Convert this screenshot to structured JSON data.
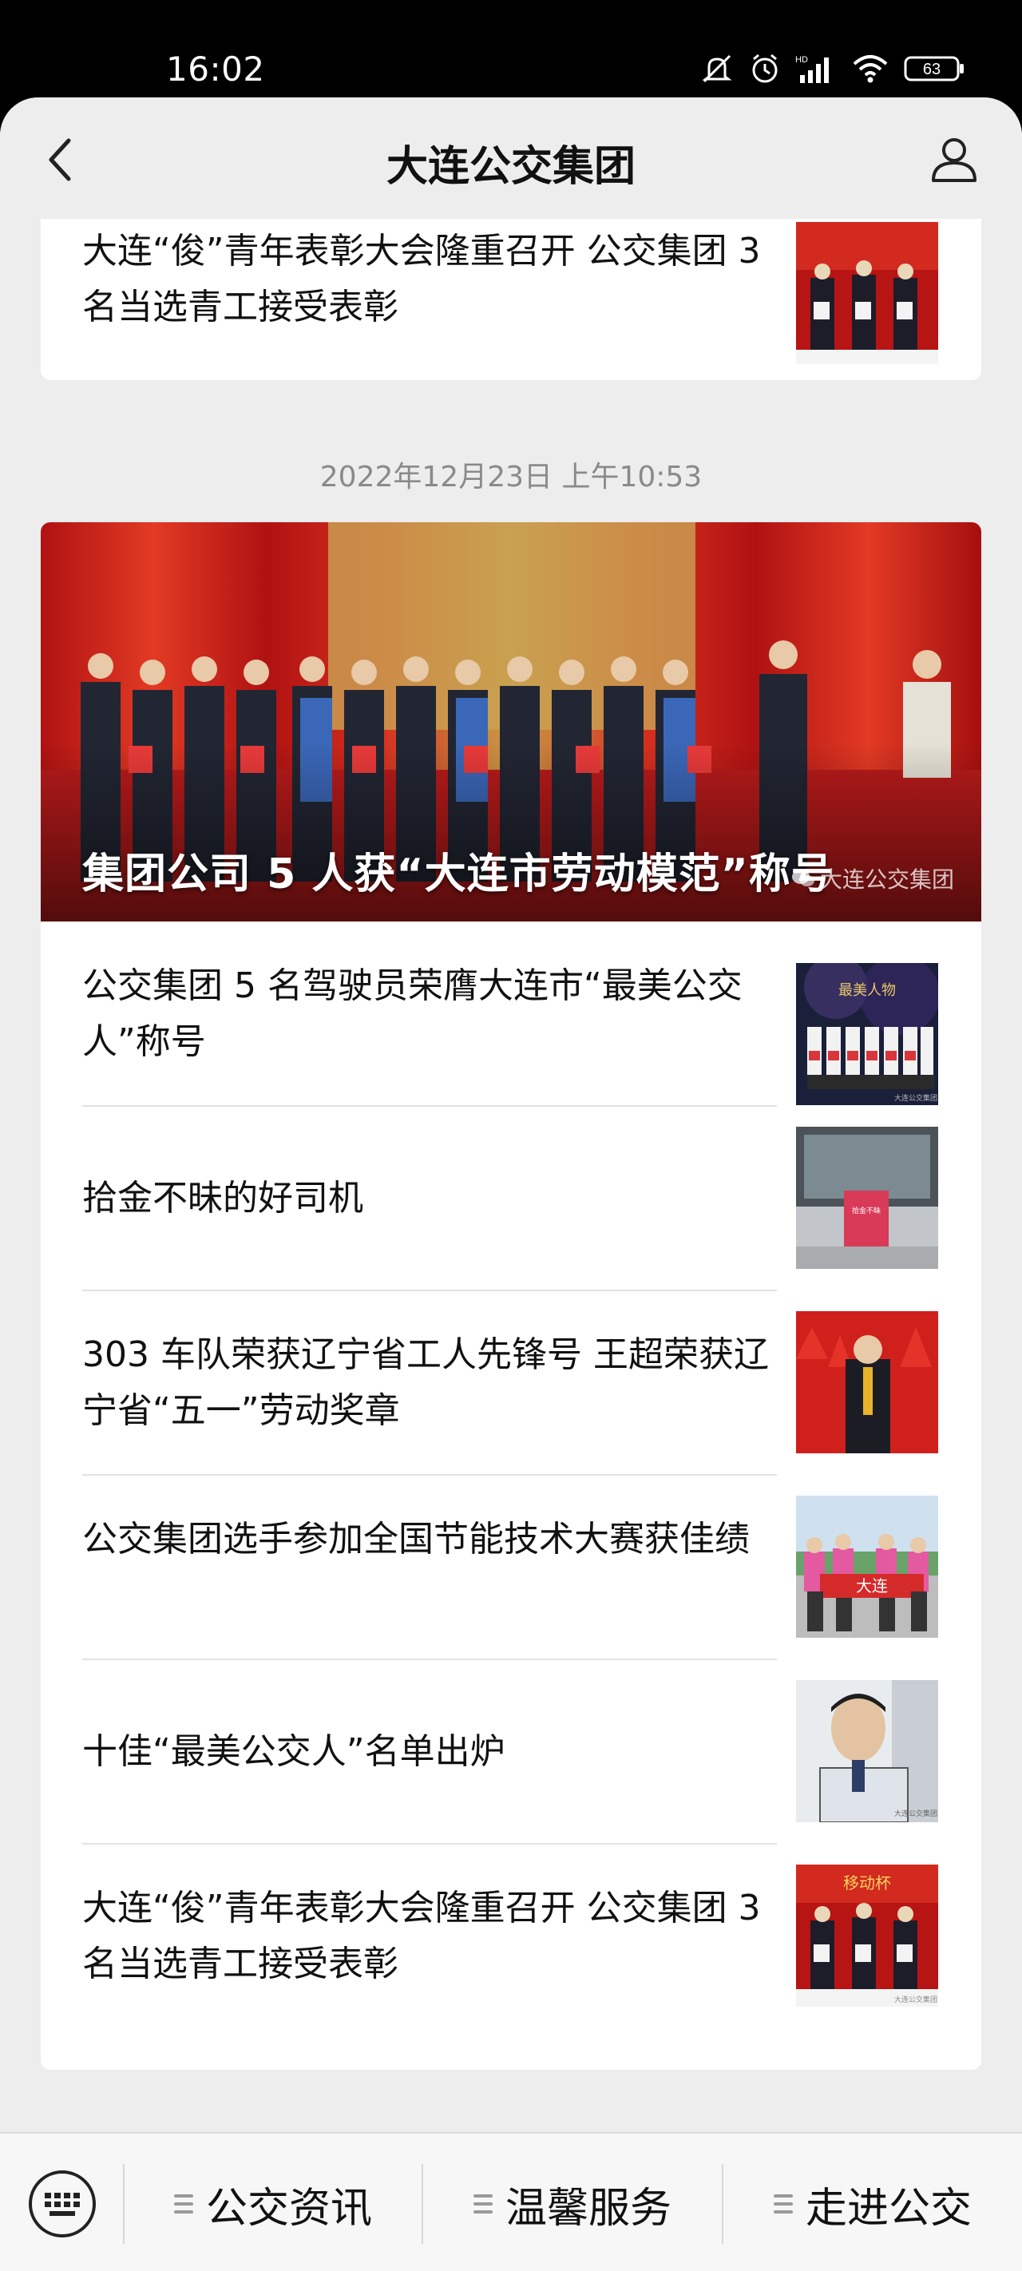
{
  "status_bar": {
    "time": "16:02",
    "battery": "63",
    "icons": [
      "mute-icon",
      "alarm-icon",
      "hd-signal-icon",
      "wifi-icon",
      "battery-icon"
    ]
  },
  "header": {
    "title": "大连公交集团",
    "back_icon": "chevron-left-icon",
    "profile_icon": "user-icon"
  },
  "card1": {
    "item": {
      "title": "大连“俊”青年表彰大会隆重召开 公交集团 3 名当选青工接受表彰"
    }
  },
  "timestamp": "2022年12月23日 上午10:53",
  "card2": {
    "hero": {
      "title": "集团公司 5 人获“大连市劳动模范”称号",
      "watermark": "大连公交集团"
    },
    "items": [
      {
        "title": "公交集团 5 名驾驶员荣膺大连市“最美公交人”称号",
        "thumb_watermark": "大连公交集团"
      },
      {
        "title": "拾金不昧的好司机"
      },
      {
        "title": "303 车队荣获辽宁省工人先锋号 王超荣获辽宁省“五一”劳动奖章"
      },
      {
        "title": "公交集团选手参加全国节能技术大赛获佳绩",
        "thumb_banner": "大连"
      },
      {
        "title": "十佳“最美公交人”名单出炉",
        "thumb_watermark": "大连公交集团"
      },
      {
        "title": "大连“俊”青年表彰大会隆重召开 公交集团 3 名当选青工接受表彰",
        "thumb_watermark": "大连公交集团",
        "thumb_banner": "移动杯"
      }
    ]
  },
  "bottom_menu": {
    "keyboard_icon": "keyboard-icon",
    "items": [
      {
        "label": "公交资讯"
      },
      {
        "label": "温馨服务"
      },
      {
        "label": "走进公交"
      }
    ]
  },
  "colors": {
    "background": "#ededed",
    "card": "#ffffff",
    "text": "#111111",
    "timestamp": "#8a8a8a",
    "stage_red": "#c8201e"
  }
}
